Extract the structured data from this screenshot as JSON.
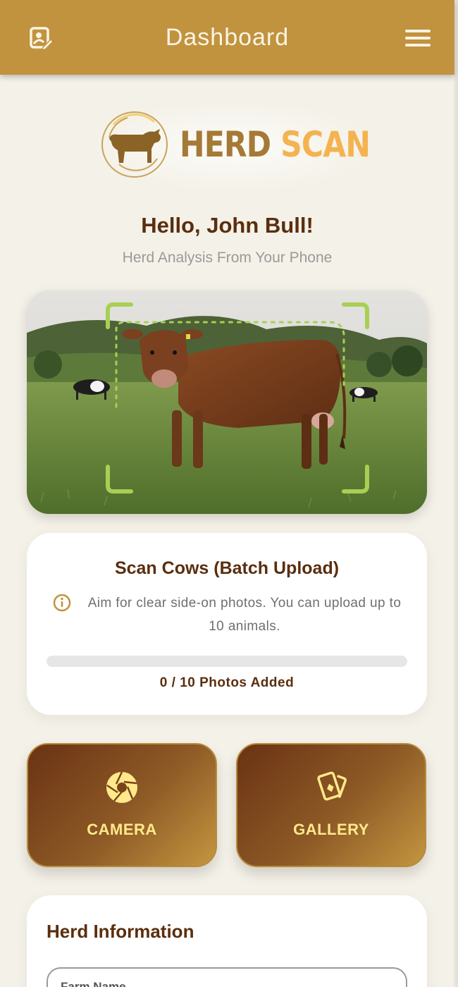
{
  "header": {
    "title": "Dashboard",
    "edit_icon": "edit-profile-icon",
    "menu_icon": "hamburger-menu-icon"
  },
  "logo": {
    "word1": "HERD",
    "word2": "SCAN",
    "word1_color": "#a57a36",
    "word2_color": "#f4b350"
  },
  "greeting": "Hello, John Bull!",
  "subtitle": "Herd Analysis From Your Phone",
  "scan_card": {
    "title": "Scan Cows (Batch Upload)",
    "hint": "Aim for clear side-on photos. You can upload up to 10 animals.",
    "progress_label": "0 / 10 Photos Added",
    "progress_fraction": 0
  },
  "actions": {
    "camera_label": "CAMERA",
    "gallery_label": "GALLERY"
  },
  "herd_info": {
    "title": "Herd Information",
    "farm_name_label": "Farm Name"
  },
  "colors": {
    "primary": "#c1933f",
    "dark_brown": "#5a2e0e",
    "accent_yellow": "#ffe98a",
    "frame_green": "#a8cf55"
  }
}
